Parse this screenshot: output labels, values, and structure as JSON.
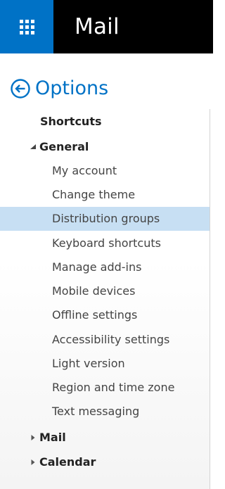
{
  "app": {
    "title": "Mail"
  },
  "options": {
    "title": "Options"
  },
  "nav": {
    "shortcuts": "Shortcuts",
    "general": {
      "label": "General",
      "items": [
        "My account",
        "Change theme",
        "Distribution groups",
        "Keyboard shortcuts",
        "Manage add-ins",
        "Mobile devices",
        "Offline settings",
        "Accessibility settings",
        "Light version",
        "Region and time zone",
        "Text messaging"
      ],
      "selected": "Distribution groups"
    },
    "mail": "Mail",
    "calendar": "Calendar"
  },
  "colors": {
    "accent": "#0072c6",
    "topbar": "#000000",
    "selected_bg": "#c7dff3"
  },
  "icons": {
    "launcher": "app-launcher-waffle-icon",
    "back": "back-arrow-circle-icon",
    "expanded": "triangle-down-icon",
    "collapsed": "triangle-right-icon"
  }
}
